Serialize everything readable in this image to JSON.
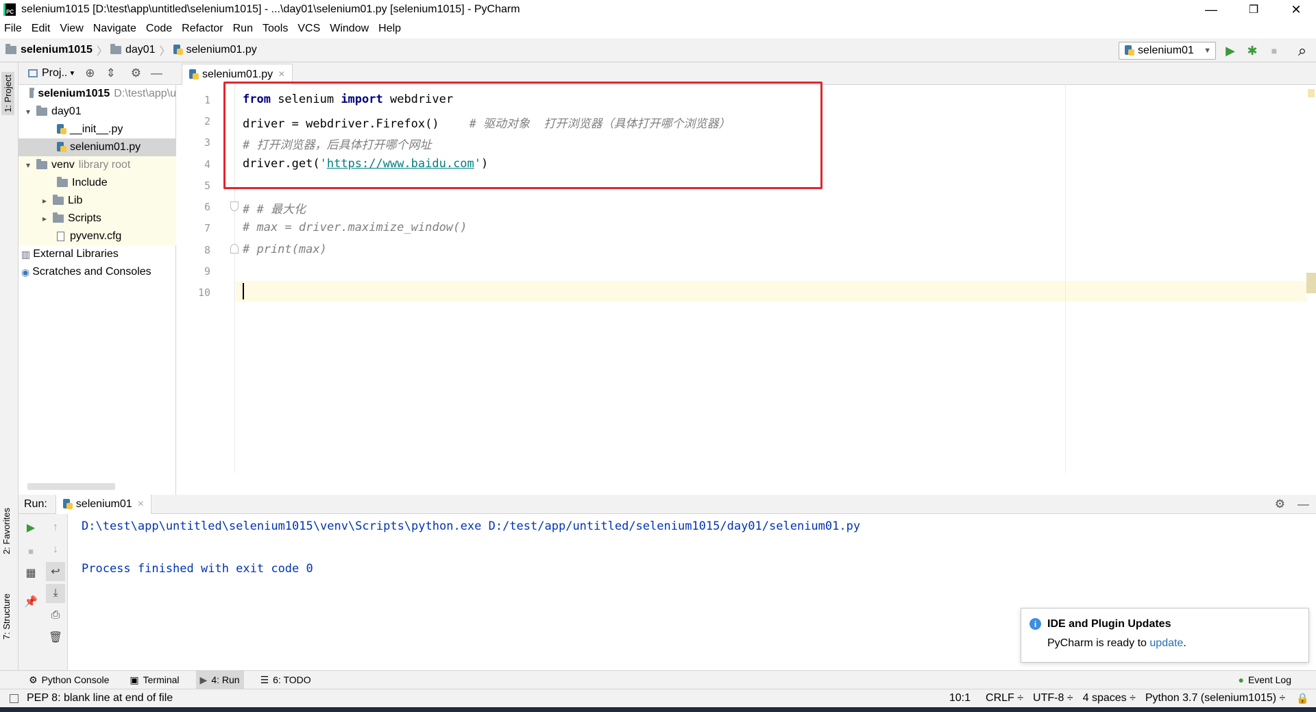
{
  "window": {
    "title": "selenium1015 [D:\\test\\app\\untitled\\selenium1015] - ...\\day01\\selenium01.py [selenium1015] - PyCharm",
    "minimize": "—",
    "restore": "❐",
    "close": "✕"
  },
  "menu": [
    "File",
    "Edit",
    "View",
    "Navigate",
    "Code",
    "Refactor",
    "Run",
    "Tools",
    "VCS",
    "Window",
    "Help"
  ],
  "breadcrumb": {
    "project": "selenium1015",
    "folder": "day01",
    "file": "selenium01.py"
  },
  "toolbar": {
    "run_config": "selenium01",
    "run_icon": "▶",
    "debug_icon": "✱",
    "stop_icon": "■",
    "search_icon": "⌕"
  },
  "side_tabs": {
    "project": "1: Project",
    "favorites": "2: Favorites",
    "structure": "7: Structure"
  },
  "project_panel": {
    "header": "Proj..",
    "tree": [
      {
        "label": "selenium1015",
        "extra": "D:\\test\\app\\u"
      },
      {
        "label": "day01",
        "extra": ""
      },
      {
        "label": "__init__.py",
        "extra": ""
      },
      {
        "label": "selenium01.py",
        "extra": ""
      },
      {
        "label": "venv",
        "extra": "library root"
      },
      {
        "label": "Include",
        "extra": ""
      },
      {
        "label": "Lib",
        "extra": ""
      },
      {
        "label": "Scripts",
        "extra": ""
      },
      {
        "label": "pyvenv.cfg",
        "extra": ""
      },
      {
        "label": "External Libraries",
        "extra": ""
      },
      {
        "label": "Scratches and Consoles",
        "extra": ""
      }
    ]
  },
  "editor": {
    "tab": "selenium01.py",
    "tab_close": "×",
    "line_numbers": [
      "1",
      "2",
      "3",
      "4",
      "5",
      "6",
      "7",
      "8",
      "9",
      "10"
    ],
    "lines": {
      "l1_kw1": "from",
      "l1_mod": " selenium ",
      "l1_kw2": "import",
      "l1_name": " webdriver",
      "l2_code": "driver = webdriver.Firefox()",
      "l2_comment": "# 驱动对象  打开浏览器（具体打开哪个浏览器）",
      "l3_comment": "# 打开浏览器，后具体打开哪个网址",
      "l4_pre": "driver.get(",
      "l4_q1": "'",
      "l4_url": "https://www.baidu.com",
      "l4_q2": "'",
      "l4_post": ")",
      "l6_comment": "# # 最大化",
      "l7_comment": "# max = driver.maximize_window()",
      "l8_comment": "# print(max)"
    }
  },
  "run": {
    "label": "Run:",
    "tab": "selenium01",
    "tab_close": "×",
    "output_cmd": "D:\\test\\app\\untitled\\selenium1015\\venv\\Scripts\\python.exe D:/test/app/untitled/selenium1015/day01/selenium01.py",
    "output_exit": "Process finished with exit code 0"
  },
  "notification": {
    "title": "IDE and Plugin Updates",
    "body": "PyCharm is ready to ",
    "link": "update",
    "end": "."
  },
  "bottom_tabs": {
    "python_console": "Python Console",
    "terminal": "Terminal",
    "run": "4: Run",
    "todo": "6: TODO",
    "event_log": "Event Log"
  },
  "status": {
    "message": "PEP 8: blank line at end of file",
    "position": "10:1",
    "line_sep": "CRLF ÷",
    "encoding": "UTF-8 ÷",
    "indent": "4 spaces ÷",
    "interpreter": "Python 3.7 (selenium1015) ÷"
  }
}
